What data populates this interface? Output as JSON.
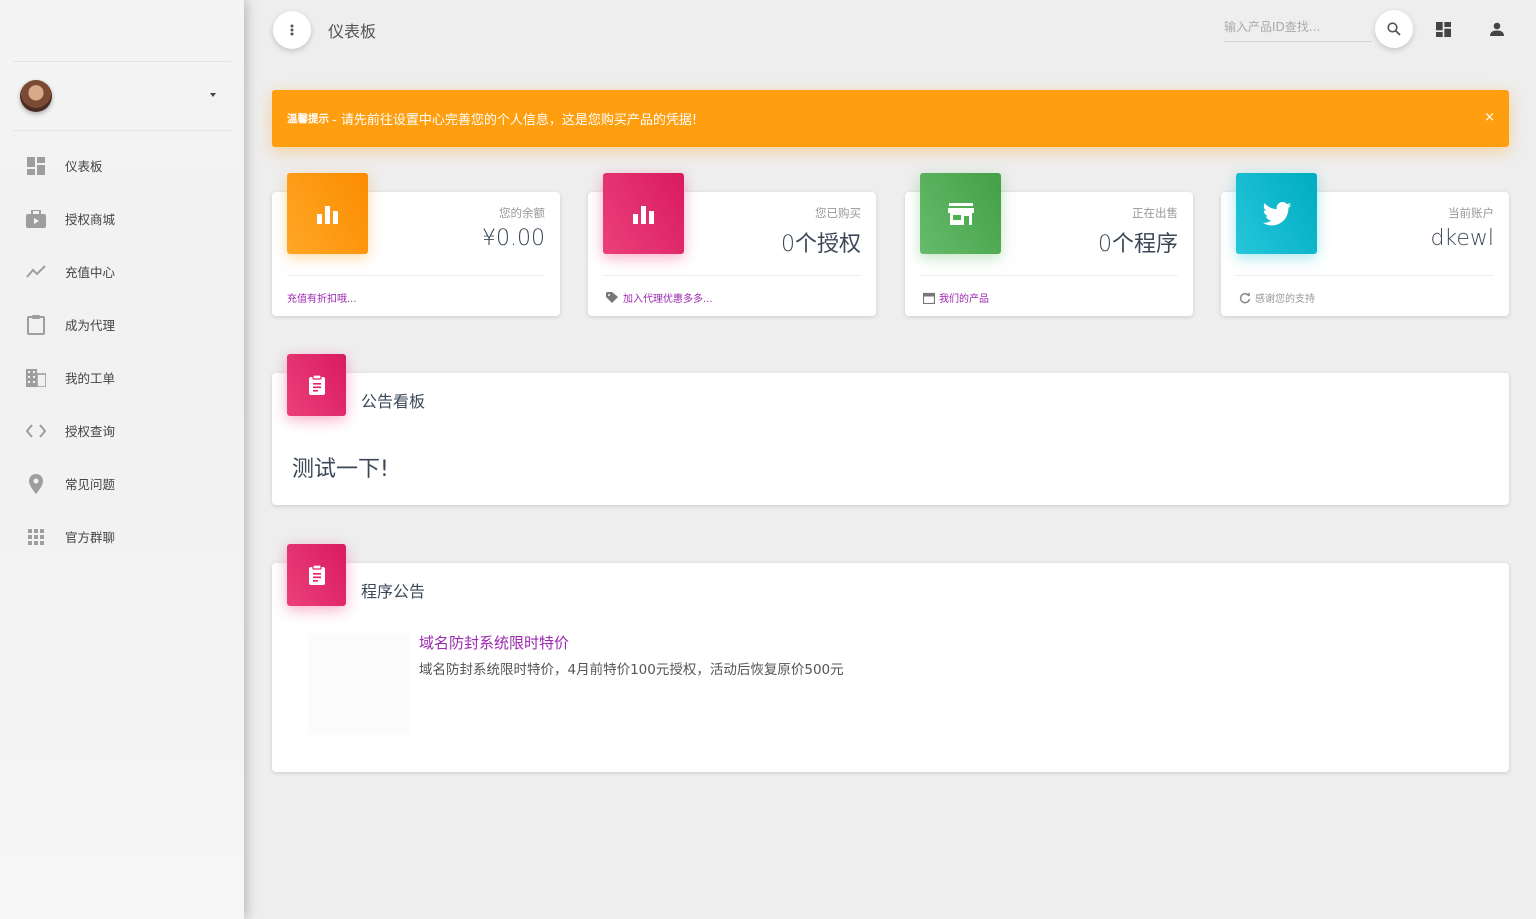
{
  "sidebar": {
    "items": [
      {
        "label": "仪表板",
        "icon": "dashboard-icon"
      },
      {
        "label": "授权商城",
        "icon": "shopping-bag-icon"
      },
      {
        "label": "充值中心",
        "icon": "trending-up-icon"
      },
      {
        "label": "成为代理",
        "icon": "clipboard-icon"
      },
      {
        "label": "我的工单",
        "icon": "building-icon"
      },
      {
        "label": "授权查询",
        "icon": "code-icon"
      },
      {
        "label": "常见问题",
        "icon": "location-pin-icon"
      },
      {
        "label": "官方群聊",
        "icon": "apps-grid-icon"
      }
    ]
  },
  "header": {
    "title": "仪表板",
    "search_placeholder": "输入产品ID查找..."
  },
  "alert": {
    "strong": "温馨提示",
    "message": " - 请先前往设置中心完善您的个人信息，这是您购买产品的凭据!",
    "close": "×",
    "color": "#ff9e0f"
  },
  "stats": [
    {
      "category": "您的余额",
      "value": "¥0.00",
      "footer": "充值有折扣哦...",
      "color": "#ff9800",
      "icon": "bar-chart-icon"
    },
    {
      "category": "您已购买",
      "value": "0个授权",
      "footer": "加入代理优惠多多...",
      "color": "#e91e63",
      "icon": "bar-chart-icon"
    },
    {
      "category": "正在出售",
      "value": "0个程序",
      "footer": "我们的产品",
      "color": "#4caf50",
      "icon": "store-icon"
    },
    {
      "category": "当前账户",
      "value": "dkewl",
      "footer": "感谢您的支持",
      "color": "#00bcd4",
      "icon": "twitter-icon"
    }
  ],
  "notice_board": {
    "title": "公告看板",
    "text": "测试一下!"
  },
  "program_board": {
    "title": "程序公告",
    "link": "域名防封系统限时特价",
    "description": "域名防封系统限时特价，4月前特价100元授权，活动后恢复原价500元"
  }
}
